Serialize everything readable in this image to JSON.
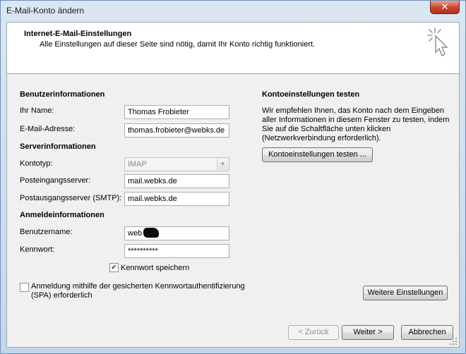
{
  "window": {
    "title": "E-Mail-Konto ändern",
    "close_glyph": "✕"
  },
  "header": {
    "title": "Internet-E-Mail-Einstellungen",
    "subtitle": "Alle Einstellungen auf dieser Seite sind nötig, damit Ihr Konto richtig funktioniert.",
    "icon": "cursor-sparkle-icon"
  },
  "user_info": {
    "heading": "Benutzerinformationen",
    "name_label": "Ihr Name:",
    "name_value": "Thomas Frobieter",
    "email_label": "E-Mail-Adresse:",
    "email_value": "thomas.frobieter@webks.de"
  },
  "server_info": {
    "heading": "Serverinformationen",
    "account_type_label": "Kontotyp:",
    "account_type_value": "IMAP",
    "incoming_label": "Posteingangsserver:",
    "incoming_value": "mail.webks.de",
    "outgoing_label": "Postausgangsserver (SMTP):",
    "outgoing_value": "mail.webks.de"
  },
  "login_info": {
    "heading": "Anmeldeinformationen",
    "username_label": "Benutzername:",
    "username_value": "web",
    "password_label": "Kennwort:",
    "password_value": "**********",
    "remember_label": "Kennwort speichern",
    "remember_checked": true,
    "spa_label_line1": "Anmeldung mithilfe der gesicherten Kennwortauthentifizierung",
    "spa_label_line2": "(SPA) erforderlich",
    "spa_checked": false
  },
  "test": {
    "heading": "Kontoeinstellungen testen",
    "description_lines": [
      "Wir empfehlen Ihnen, das Konto nach dem Eingeben",
      "aller Informationen in diesem Fenster zu testen, indem",
      "Sie auf die Schaltfläche unten klicken",
      "(Netzwerkverbindung erforderlich)."
    ],
    "button_label": "Kontoeinstellungen testen ..."
  },
  "buttons": {
    "more_settings": "Weitere Einstellungen",
    "back": "< Zurück",
    "next": "Weiter >",
    "cancel": "Abbrechen"
  }
}
